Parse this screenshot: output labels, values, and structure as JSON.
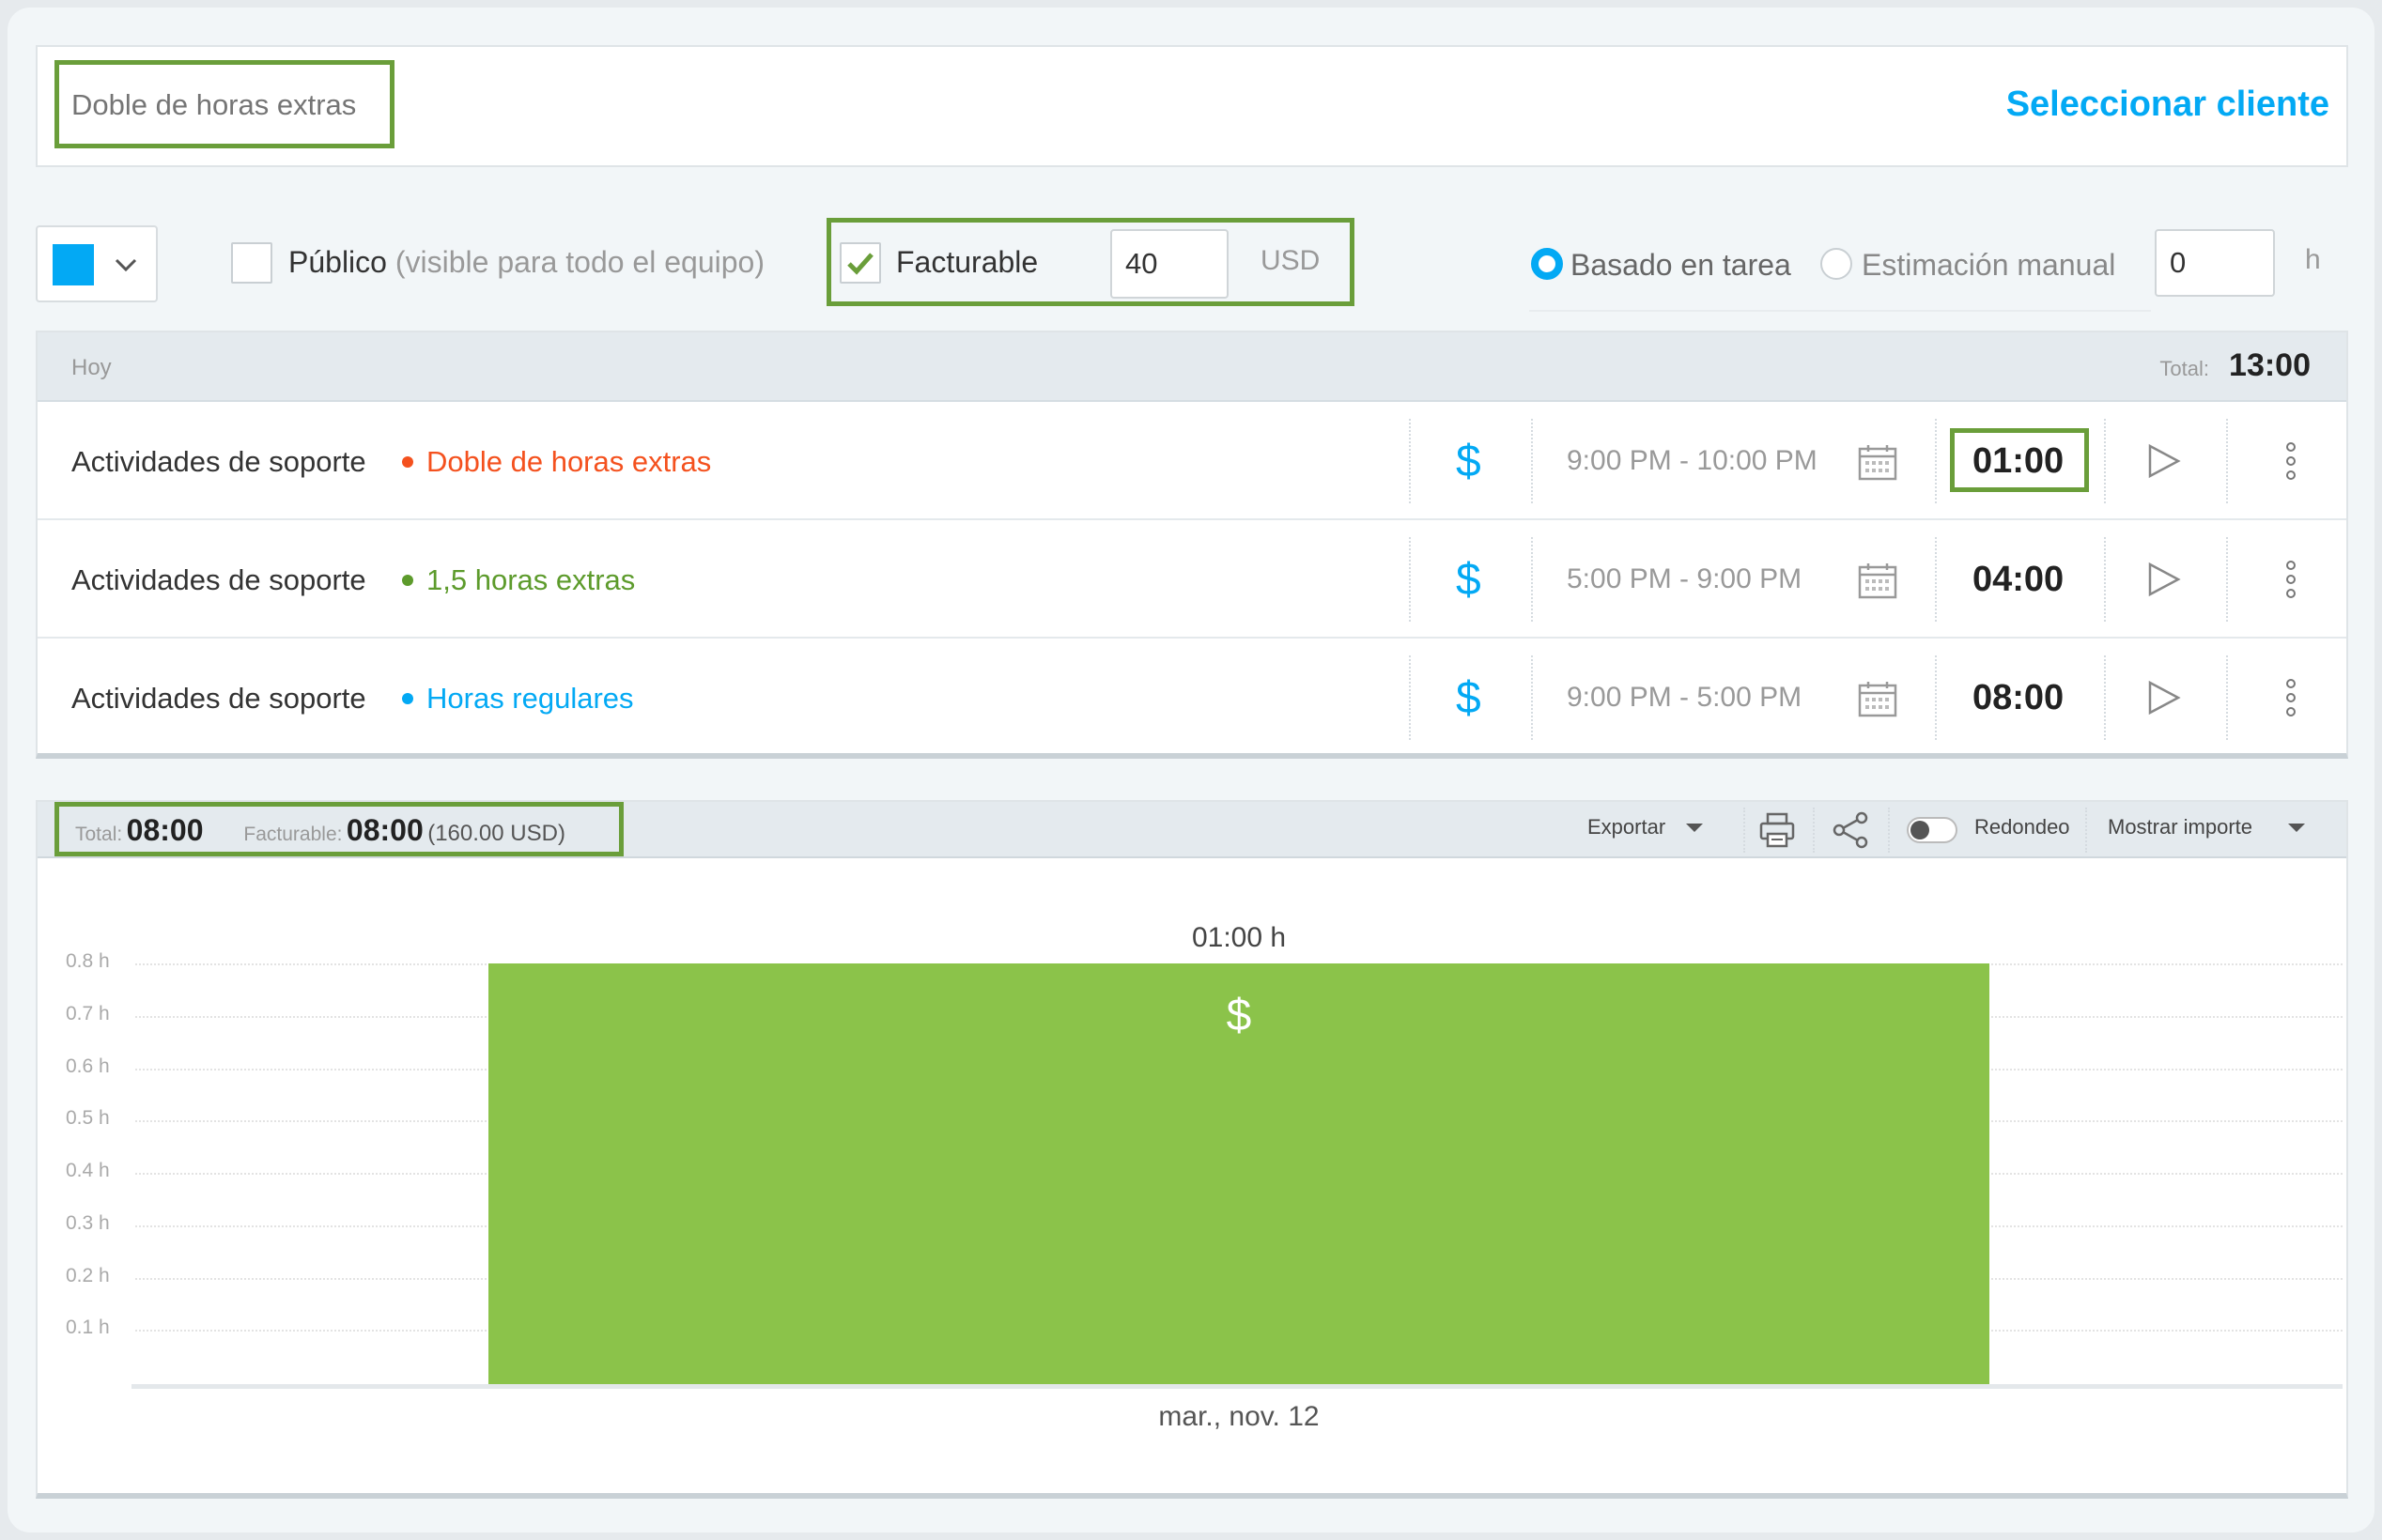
{
  "project": {
    "name_placeholder": "Doble de horas extras",
    "select_client_label": "Seleccionar cliente"
  },
  "settings": {
    "color": "#03a9f4",
    "public_label": "Público",
    "public_hint": "(visible para todo el equipo)",
    "public_checked": false,
    "billable_label": "Facturable",
    "billable_checked": true,
    "rate_value": "40",
    "currency": "USD",
    "estimate_option_task": "Basado en tarea",
    "estimate_option_manual": "Estimación manual",
    "estimate_selected": "task",
    "estimate_value": "0",
    "estimate_unit": "h"
  },
  "entries": {
    "group_label": "Hoy",
    "total_label": "Total:",
    "total_value": "13:00",
    "rows": [
      {
        "description": "Actividades de soporte",
        "task": "Doble de horas extras",
        "task_color": "#f4511e",
        "billable_icon": "$",
        "time_range": "9:00 PM - 10:00 PM",
        "duration": "01:00"
      },
      {
        "description": "Actividades de soporte",
        "task": "1,5 horas extras",
        "task_color": "#5d9b2c",
        "billable_icon": "$",
        "time_range": "5:00 PM - 9:00 PM",
        "duration": "04:00"
      },
      {
        "description": "Actividades de soporte",
        "task": "Horas regulares",
        "task_color": "#03a9f4",
        "billable_icon": "$",
        "time_range": "9:00 PM - 5:00 PM",
        "duration": "08:00"
      }
    ]
  },
  "report": {
    "total_label": "Total:",
    "total_value": "08:00",
    "billable_label": "Facturable:",
    "billable_value": "08:00",
    "billable_amount": "(160.00 USD)",
    "export_label": "Exportar",
    "rounding_label": "Redondeo",
    "rounding_on": false,
    "show_amount_label": "Mostrar importe"
  },
  "chart_data": {
    "type": "bar",
    "categories": [
      "mar., nov. 12"
    ],
    "values": [
      1.0
    ],
    "data_labels": [
      "01:00 h"
    ],
    "bar_icon": "$",
    "bar_color": "#8bc34a",
    "ylim": [
      0,
      0.8
    ],
    "y_ticks": [
      0.1,
      0.2,
      0.3,
      0.4,
      0.5,
      0.6,
      0.7,
      0.8
    ],
    "y_tick_labels": [
      "0.1 h",
      "0.2 h",
      "0.3 h",
      "0.4 h",
      "0.5 h",
      "0.6 h",
      "0.7 h",
      "0.8 h"
    ],
    "grid": true
  }
}
